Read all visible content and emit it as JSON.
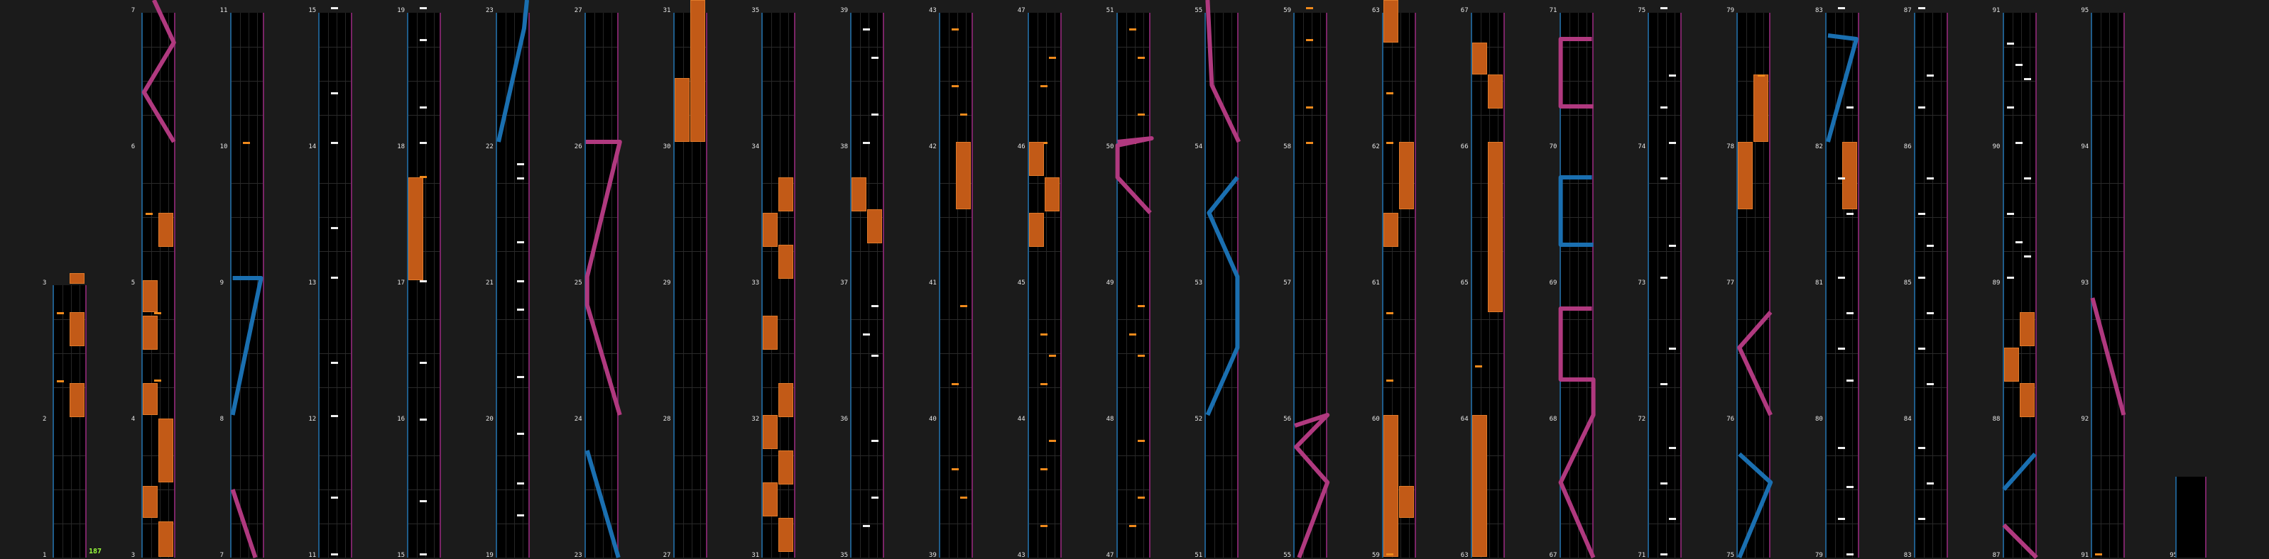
{
  "app": {
    "combo_counter": "187",
    "colors": {
      "background": "#1b1b1b",
      "lane_bg": "#000000",
      "left_rail": "#1f5c8a",
      "right_rail": "#7a2466",
      "hold": "#c25a17",
      "note_white": "#f0f0f0",
      "note_orange": "#f08a1c",
      "slide_blue": "#1a6fb0",
      "slide_pink": "#b0397f",
      "combo_green": "#9bff3c"
    }
  },
  "measure_labels": [
    "1",
    "2",
    "3",
    "3",
    "4",
    "5",
    "6",
    "7",
    "7",
    "8",
    "9",
    "10",
    "11",
    "11",
    "12",
    "13",
    "14",
    "15",
    "15",
    "16",
    "17",
    "18",
    "19",
    "19",
    "20",
    "21",
    "22",
    "23",
    "23",
    "24",
    "25",
    "26",
    "27",
    "27",
    "28",
    "29",
    "30",
    "31",
    "31",
    "32",
    "33",
    "34",
    "35",
    "35",
    "36",
    "37",
    "38",
    "39",
    "39",
    "40",
    "41",
    "42",
    "43",
    "43",
    "44",
    "45",
    "46",
    "47",
    "47",
    "48",
    "49",
    "50",
    "51",
    "51",
    "52",
    "53",
    "54",
    "55",
    "55",
    "56",
    "57",
    "58",
    "59",
    "59",
    "60",
    "61",
    "62",
    "63",
    "63",
    "64",
    "65",
    "66",
    "67",
    "67",
    "68",
    "69",
    "70",
    "71",
    "71",
    "72",
    "73",
    "74",
    "75",
    "75",
    "76",
    "77",
    "78",
    "79",
    "79",
    "80",
    "81",
    "82",
    "83",
    "83",
    "84",
    "85",
    "86",
    "87",
    "87",
    "88",
    "89",
    "90",
    "91",
    "91",
    "92",
    "93",
    "94",
    "95",
    "95"
  ],
  "columns": [
    {
      "col": 0,
      "measures": [
        "1",
        "2",
        "3"
      ]
    },
    {
      "col": 1,
      "measures": [
        "3",
        "4",
        "5",
        "6",
        "7"
      ]
    },
    {
      "col": 2,
      "measures": [
        "7",
        "8",
        "9",
        "10",
        "11"
      ]
    },
    {
      "col": 3,
      "measures": [
        "11",
        "12",
        "13",
        "14",
        "15"
      ]
    },
    {
      "col": 4,
      "measures": [
        "15",
        "16",
        "17",
        "18",
        "19"
      ]
    },
    {
      "col": 5,
      "measures": [
        "19",
        "20",
        "21",
        "22",
        "23"
      ]
    },
    {
      "col": 6,
      "measures": [
        "23",
        "24",
        "25",
        "26",
        "27"
      ]
    },
    {
      "col": 7,
      "measures": [
        "27",
        "28",
        "29",
        "30",
        "31"
      ]
    },
    {
      "col": 8,
      "measures": [
        "31",
        "32",
        "33",
        "34",
        "35"
      ]
    },
    {
      "col": 9,
      "measures": [
        "35",
        "36",
        "37",
        "38",
        "39"
      ]
    },
    {
      "col": 10,
      "measures": [
        "39",
        "40",
        "41",
        "42",
        "43"
      ]
    },
    {
      "col": 11,
      "measures": [
        "43",
        "44",
        "45",
        "46",
        "47"
      ]
    },
    {
      "col": 12,
      "measures": [
        "47",
        "48",
        "49",
        "50",
        "51"
      ]
    },
    {
      "col": 13,
      "measures": [
        "51",
        "52",
        "53",
        "54",
        "55"
      ]
    },
    {
      "col": 14,
      "measures": [
        "55",
        "56",
        "57",
        "58",
        "59"
      ]
    },
    {
      "col": 15,
      "measures": [
        "59",
        "60",
        "61",
        "62",
        "63"
      ]
    },
    {
      "col": 16,
      "measures": [
        "63",
        "64",
        "65",
        "66",
        "67"
      ]
    },
    {
      "col": 17,
      "measures": [
        "67",
        "68",
        "69",
        "70",
        "71"
      ]
    },
    {
      "col": 18,
      "measures": [
        "71",
        "72",
        "73",
        "74",
        "75"
      ]
    },
    {
      "col": 19,
      "measures": [
        "75",
        "76",
        "77",
        "78",
        "79"
      ]
    },
    {
      "col": 20,
      "measures": [
        "79",
        "80",
        "81",
        "82",
        "83"
      ]
    },
    {
      "col": 21,
      "measures": [
        "83",
        "84",
        "85",
        "86",
        "87"
      ]
    },
    {
      "col": 22,
      "measures": [
        "87",
        "88",
        "89",
        "90",
        "91"
      ]
    },
    {
      "col": 23,
      "measures": [
        "91",
        "92",
        "93",
        "94",
        "95"
      ]
    },
    {
      "col": 24,
      "measures": [
        "95"
      ]
    }
  ]
}
